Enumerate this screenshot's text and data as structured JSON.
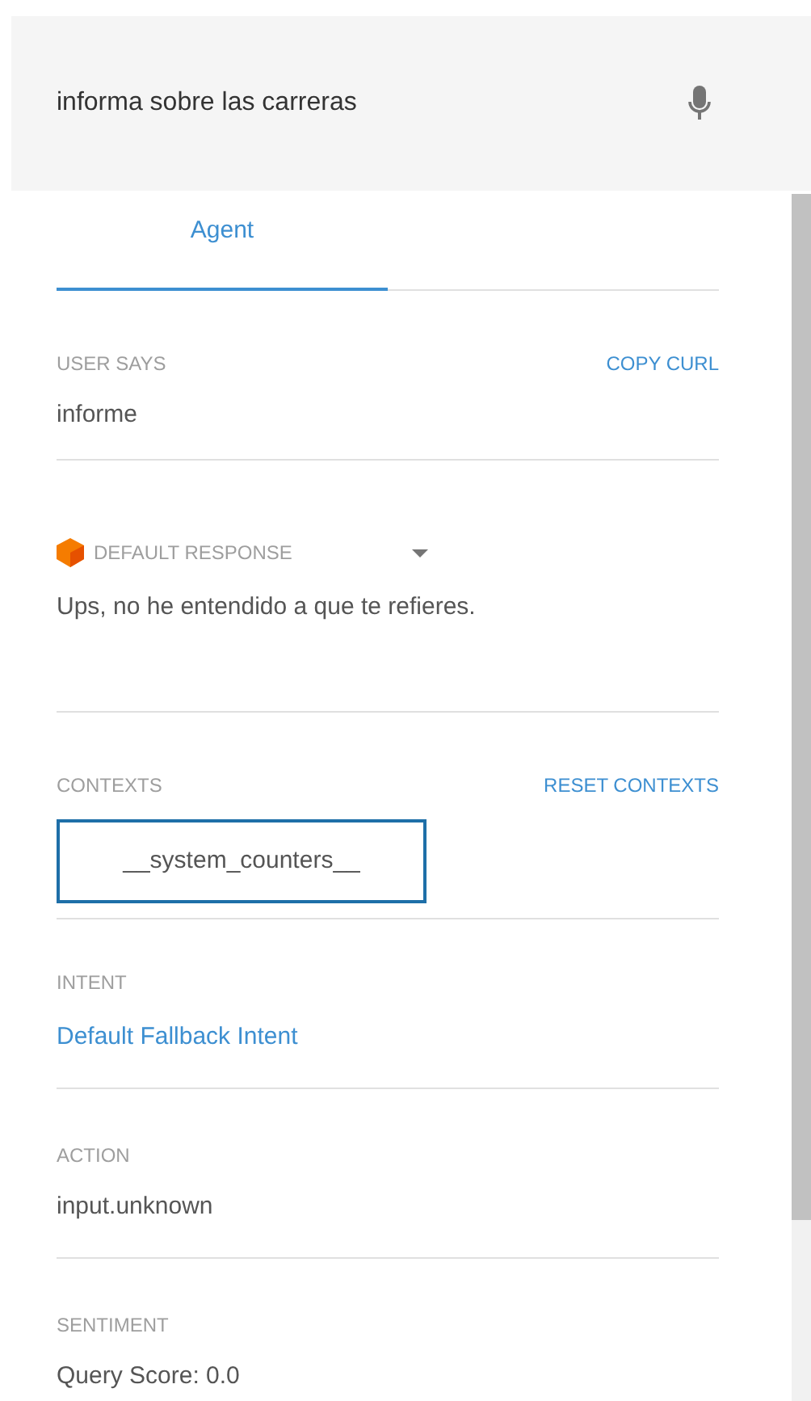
{
  "query": {
    "value": "informa sobre las carreras"
  },
  "tabs": [
    {
      "label": "Agent",
      "selected": true
    }
  ],
  "user_says": {
    "label": "USER SAYS",
    "action": "COPY CURL",
    "value": "informe"
  },
  "response": {
    "label": "DEFAULT RESPONSE",
    "value": "Ups, no he entendido a que te refieres."
  },
  "contexts": {
    "label": "CONTEXTS",
    "action": "RESET CONTEXTS",
    "items": [
      "__system_counters__"
    ]
  },
  "intent": {
    "label": "INTENT",
    "value": "Default Fallback Intent"
  },
  "action": {
    "label": "ACTION",
    "value": "input.unknown"
  },
  "sentiment": {
    "label": "SENTIMENT",
    "value": "Query Score: 0.0"
  }
}
